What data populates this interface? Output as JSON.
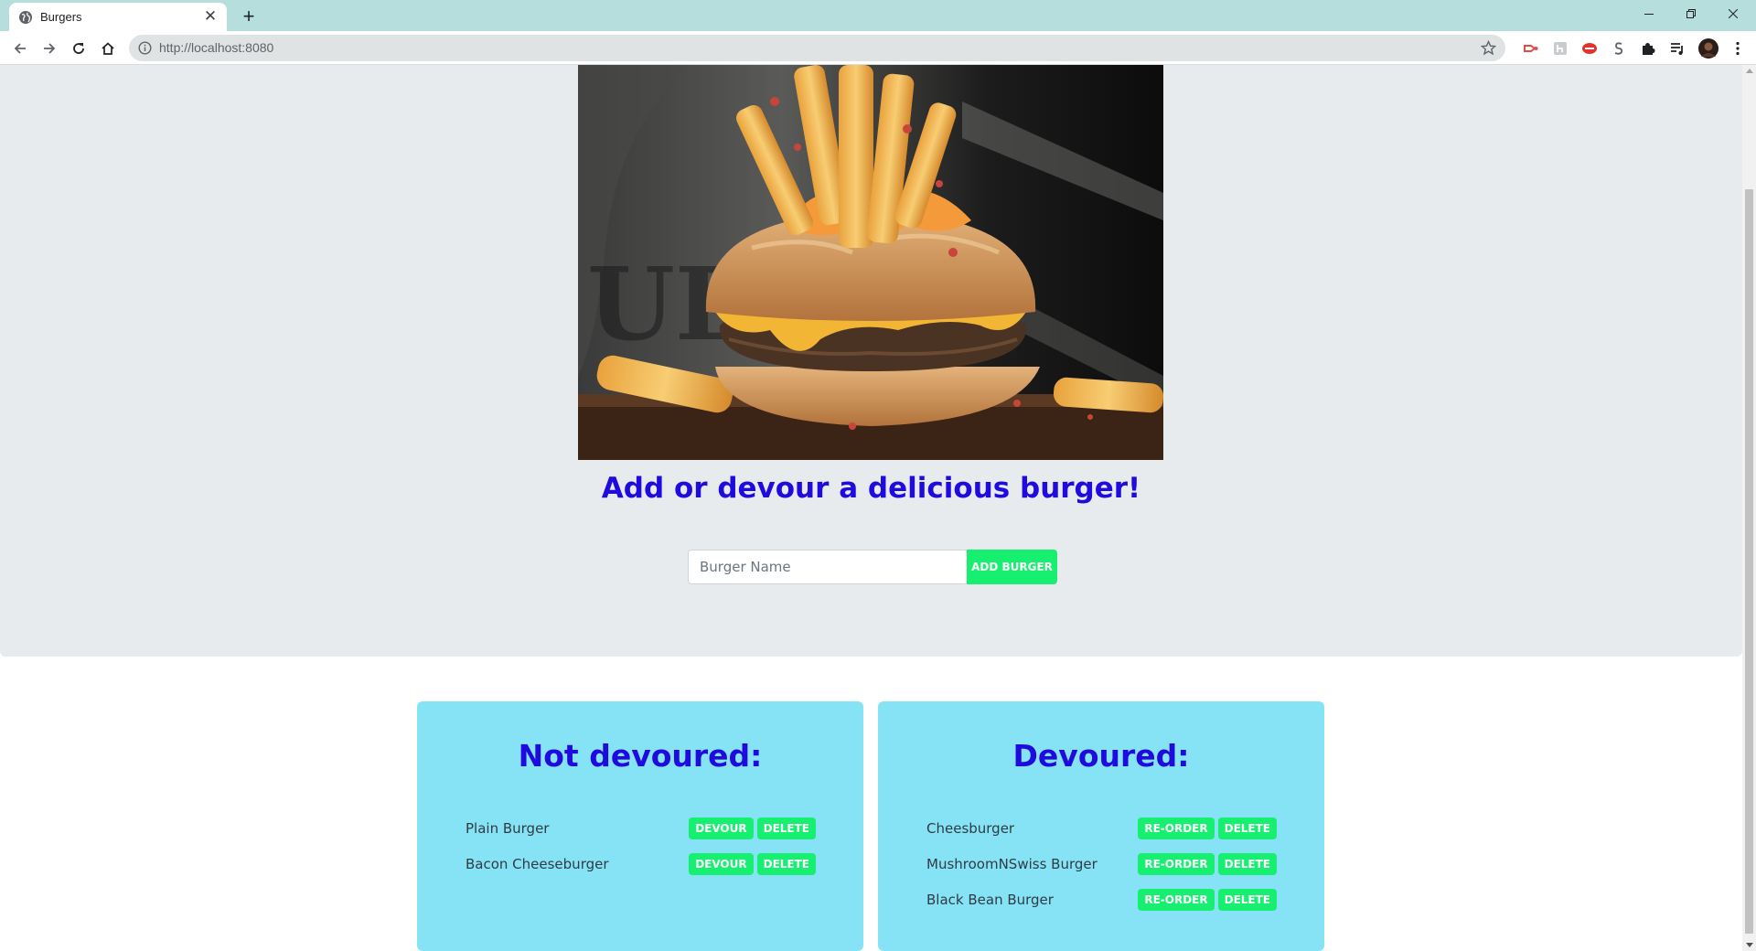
{
  "browser": {
    "tab_title": "Burgers",
    "url_host": "http://localhost:",
    "url_port": "8080"
  },
  "hero": {
    "headline": "Add or devour a delicious burger!"
  },
  "form": {
    "placeholder": "Burger Name",
    "value": "",
    "submit_label": "ADD BURGER"
  },
  "not_devoured": {
    "title": "Not devoured:",
    "items": [
      {
        "name": "Plain Burger",
        "action_label": "DEVOUR",
        "delete_label": "DELETE"
      },
      {
        "name": "Bacon Cheeseburger",
        "action_label": "DEVOUR",
        "delete_label": "DELETE"
      }
    ]
  },
  "devoured": {
    "title": "Devoured:",
    "items": [
      {
        "name": "Cheesburger",
        "action_label": "RE-ORDER",
        "delete_label": "DELETE"
      },
      {
        "name": "MushroomNSwiss Burger",
        "action_label": "RE-ORDER",
        "delete_label": "DELETE"
      },
      {
        "name": "Black Bean Burger",
        "action_label": "RE-ORDER",
        "delete_label": "DELETE"
      }
    ]
  },
  "colors": {
    "accent_green": "#16ef6f",
    "heading_blue": "#1f0bdd",
    "card_cyan": "#86e3f5",
    "jumbotron_gray": "#e8ebee",
    "tabstrip_teal": "#b6dedd"
  },
  "icons": [
    "globe-icon",
    "close-icon",
    "plus-icon",
    "minimize-icon",
    "restore-icon",
    "window-close-icon",
    "back-arrow-icon",
    "forward-arrow-icon",
    "reload-icon",
    "home-icon",
    "info-icon",
    "star-icon",
    "extension-icon",
    "puzzle-icon",
    "playlist-icon",
    "profile-avatar"
  ]
}
